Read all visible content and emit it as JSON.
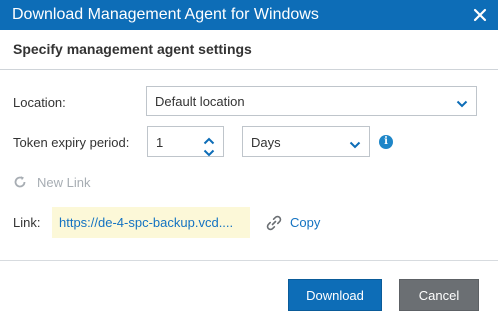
{
  "dialog": {
    "title": "Download Management Agent for Windows",
    "subheader": "Specify management agent settings",
    "close_icon": "close-icon"
  },
  "form": {
    "location": {
      "label": "Location:",
      "value": "Default location"
    },
    "token_expiry": {
      "label": "Token expiry period:",
      "value": "1",
      "unit_value": "Days"
    },
    "new_link_label": "New Link",
    "link": {
      "label": "Link:",
      "url": "https://de-4-spc-backup.vcd....",
      "copy_label": "Copy"
    }
  },
  "footer": {
    "download_label": "Download",
    "cancel_label": "Cancel"
  },
  "colors": {
    "accent": "#0d6db7",
    "link": "#1473c2",
    "link_bg": "#fcf8d8",
    "cancel_bg": "#6b6f73",
    "disabled_text": "#a7adb3"
  }
}
